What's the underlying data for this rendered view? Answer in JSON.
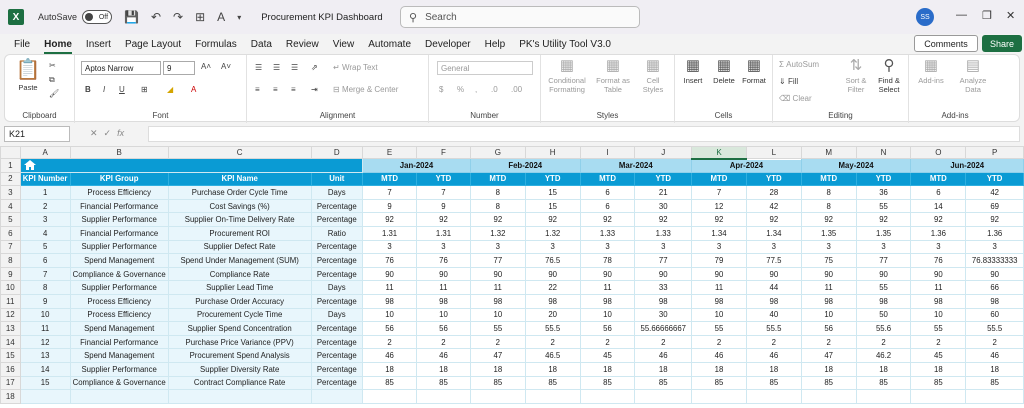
{
  "titlebar": {
    "autosave_label": "AutoSave",
    "autosave_state": "Off",
    "doc_title": "Procurement KPI Dashboard",
    "search_placeholder": "Search",
    "user_initials": "SS"
  },
  "menu": {
    "tabs": [
      "File",
      "Home",
      "Insert",
      "Page Layout",
      "Formulas",
      "Data",
      "Review",
      "View",
      "Automate",
      "Developer",
      "Help",
      "PK's Utility Tool V3.0"
    ],
    "active": "Home",
    "comments_label": "Comments",
    "share_label": "Share"
  },
  "ribbon": {
    "clipboard": {
      "paste": "Paste",
      "label": "Clipboard"
    },
    "font": {
      "name": "Aptos Narrow",
      "size": "9",
      "label": "Font"
    },
    "alignment": {
      "wrap": "Wrap Text",
      "merge": "Merge & Center",
      "label": "Alignment"
    },
    "number": {
      "format": "General",
      "label": "Number"
    },
    "styles": {
      "cond_1": "Conditional",
      "cond_2": "Formatting",
      "table_1": "Format as",
      "table_2": "Table",
      "cell_1": "Cell",
      "cell_2": "Styles",
      "label": "Styles"
    },
    "cells": {
      "insert": "Insert",
      "delete": "Delete",
      "format": "Format",
      "label": "Cells"
    },
    "editing": {
      "autosum": "AutoSum",
      "fill": "Fill",
      "clear": "Clear",
      "sort_1": "Sort &",
      "sort_2": "Filter",
      "find_1": "Find &",
      "find_2": "Select",
      "label": "Editing"
    },
    "addins": {
      "addins_1": "Add-ins",
      "analyze_1": "Analyze",
      "analyze_2": "Data",
      "label": "Add-ins"
    }
  },
  "formula": {
    "namebox": "K21",
    "fx": "fx",
    "value": ""
  },
  "sheet": {
    "columns": [
      "A",
      "B",
      "C",
      "D",
      "E",
      "F",
      "G",
      "H",
      "I",
      "J",
      "K",
      "L",
      "M",
      "N",
      "O",
      "P"
    ],
    "selected_column": "K",
    "row_numbers": [
      "1",
      "2",
      "3",
      "4",
      "5",
      "6",
      "7",
      "8",
      "9",
      "10",
      "11",
      "12",
      "13",
      "14",
      "15",
      "16",
      "17",
      "18"
    ],
    "months": [
      "Jan-2024",
      "Feb-2024",
      "Mar-2024",
      "Apr-2024",
      "May-2024",
      "Jun-2024"
    ],
    "headers": [
      "KPI Number",
      "KPI Group",
      "KPI Name",
      "Unit"
    ],
    "mtd": "MTD",
    "ytd": "YTD",
    "rows": [
      [
        "1",
        "Process Efficiency",
        "Purchase Order Cycle Time",
        "Days",
        "7",
        "7",
        "8",
        "15",
        "6",
        "21",
        "7",
        "28",
        "8",
        "36",
        "6",
        "42"
      ],
      [
        "2",
        "Financial Performance",
        "Cost Savings (%)",
        "Percentage",
        "9",
        "9",
        "8",
        "15",
        "6",
        "30",
        "12",
        "42",
        "8",
        "55",
        "14",
        "69"
      ],
      [
        "3",
        "Supplier Performance",
        "Supplier On-Time Delivery Rate",
        "Percentage",
        "92",
        "92",
        "92",
        "92",
        "92",
        "92",
        "92",
        "92",
        "92",
        "92",
        "92",
        "92"
      ],
      [
        "4",
        "Financial Performance",
        "Procurement ROI",
        "Ratio",
        "1.31",
        "1.31",
        "1.32",
        "1.32",
        "1.33",
        "1.33",
        "1.34",
        "1.34",
        "1.35",
        "1.35",
        "1.36",
        "1.36"
      ],
      [
        "5",
        "Supplier Performance",
        "Supplier Defect Rate",
        "Percentage",
        "3",
        "3",
        "3",
        "3",
        "3",
        "3",
        "3",
        "3",
        "3",
        "3",
        "3",
        "3"
      ],
      [
        "6",
        "Spend Management",
        "Spend Under Management (SUM)",
        "Percentage",
        "76",
        "76",
        "77",
        "76.5",
        "78",
        "77",
        "79",
        "77.5",
        "75",
        "77",
        "76",
        "76.83333333"
      ],
      [
        "7",
        "Compliance & Governance",
        "Compliance Rate",
        "Percentage",
        "90",
        "90",
        "90",
        "90",
        "90",
        "90",
        "90",
        "90",
        "90",
        "90",
        "90",
        "90"
      ],
      [
        "8",
        "Supplier Performance",
        "Supplier Lead Time",
        "Days",
        "11",
        "11",
        "11",
        "22",
        "11",
        "33",
        "11",
        "44",
        "11",
        "55",
        "11",
        "66"
      ],
      [
        "9",
        "Process Efficiency",
        "Purchase Order Accuracy",
        "Percentage",
        "98",
        "98",
        "98",
        "98",
        "98",
        "98",
        "98",
        "98",
        "98",
        "98",
        "98",
        "98"
      ],
      [
        "10",
        "Process Efficiency",
        "Procurement Cycle Time",
        "Days",
        "10",
        "10",
        "10",
        "20",
        "10",
        "30",
        "10",
        "40",
        "10",
        "50",
        "10",
        "60"
      ],
      [
        "11",
        "Spend Management",
        "Supplier Spend Concentration",
        "Percentage",
        "56",
        "56",
        "55",
        "55.5",
        "56",
        "55.66666667",
        "55",
        "55.5",
        "56",
        "55.6",
        "55",
        "55.5"
      ],
      [
        "12",
        "Financial Performance",
        "Purchase Price Variance (PPV)",
        "Percentage",
        "2",
        "2",
        "2",
        "2",
        "2",
        "2",
        "2",
        "2",
        "2",
        "2",
        "2",
        "2"
      ],
      [
        "13",
        "Spend Management",
        "Procurement Spend Analysis",
        "Percentage",
        "46",
        "46",
        "47",
        "46.5",
        "45",
        "46",
        "46",
        "46",
        "47",
        "46.2",
        "45",
        "46"
      ],
      [
        "14",
        "Supplier Performance",
        "Supplier Diversity Rate",
        "Percentage",
        "18",
        "18",
        "18",
        "18",
        "18",
        "18",
        "18",
        "18",
        "18",
        "18",
        "18",
        "18"
      ],
      [
        "15",
        "Compliance & Governance",
        "Contract Compliance Rate",
        "Percentage",
        "85",
        "85",
        "85",
        "85",
        "85",
        "85",
        "85",
        "85",
        "85",
        "85",
        "85",
        "85"
      ]
    ]
  }
}
